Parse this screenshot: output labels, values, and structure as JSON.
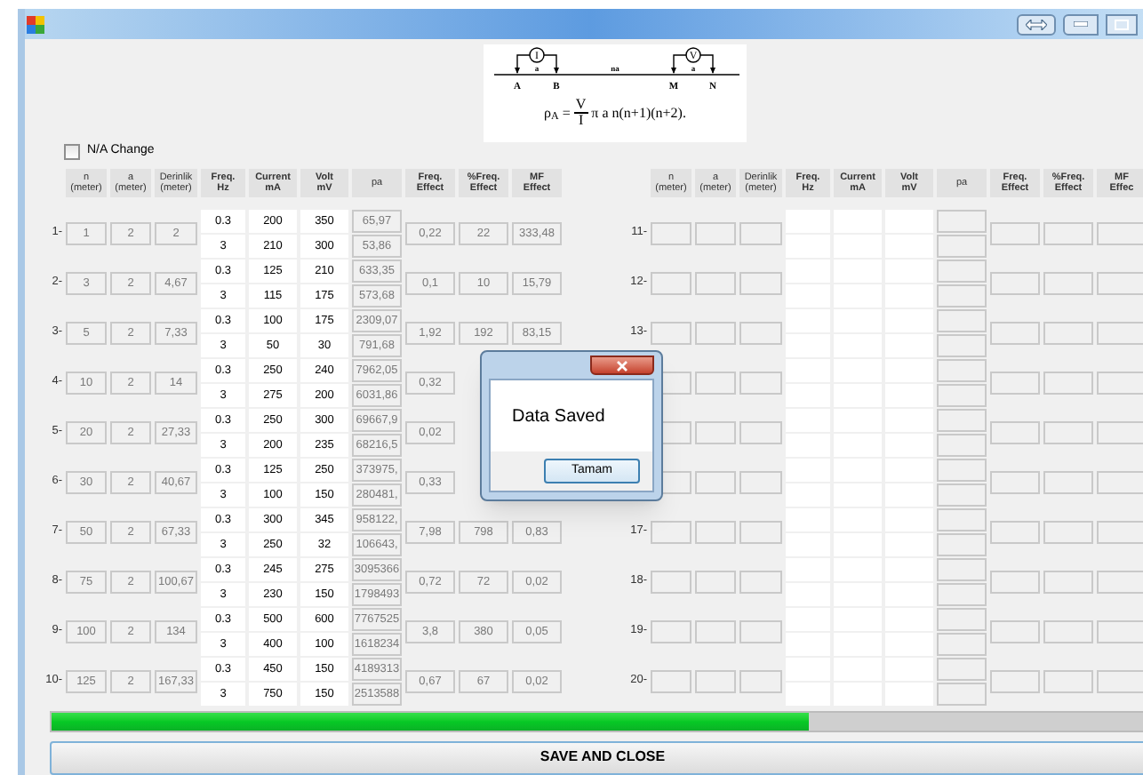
{
  "diagram": {
    "current_meter": "I",
    "voltage_meter": "V",
    "electrodes": [
      "A",
      "B",
      "M",
      "N"
    ],
    "spacings": [
      "a",
      "na",
      "a"
    ]
  },
  "formula": {
    "lhs": "ρ$_{A}$ =",
    "numerator": "V",
    "denominator": "I",
    "rhs": "π a n(n+1)(n+2)."
  },
  "na_change": {
    "label": "N/A Change",
    "checked": false
  },
  "left_table": {
    "columns": [
      {
        "lines": [
          "n",
          "(meter)"
        ]
      },
      {
        "lines": [
          "a",
          "(meter)"
        ]
      },
      {
        "lines": [
          "Derinlik",
          "(meter)"
        ]
      },
      {
        "lines": [
          "Freq.",
          "Hz"
        ]
      },
      {
        "lines": [
          "Current",
          "mA"
        ]
      },
      {
        "lines": [
          "Volt",
          "mV"
        ]
      },
      {
        "lines": [
          "pa"
        ]
      },
      {
        "lines": [
          "Freq.",
          "Effect"
        ]
      },
      {
        "lines": [
          "%Freq.",
          "Effect"
        ]
      },
      {
        "lines": [
          "MF",
          "Effect"
        ]
      }
    ],
    "rows": [
      {
        "label": "1-",
        "n": "1",
        "a": "2",
        "depth": "2",
        "freq": [
          "0.3",
          "3"
        ],
        "current": [
          "200",
          "210"
        ],
        "volt": [
          "350",
          "300"
        ],
        "pa": [
          "65,97",
          "53,86"
        ],
        "freq_effect": "0,22",
        "pct_freq_effect": "22",
        "mf_effect": "333,48"
      },
      {
        "label": "2-",
        "n": "3",
        "a": "2",
        "depth": "4,67",
        "freq": [
          "0.3",
          "3"
        ],
        "current": [
          "125",
          "115"
        ],
        "volt": [
          "210",
          "175"
        ],
        "pa": [
          "633,35",
          "573,68"
        ],
        "freq_effect": "0,1",
        "pct_freq_effect": "10",
        "mf_effect": "15,79"
      },
      {
        "label": "3-",
        "n": "5",
        "a": "2",
        "depth": "7,33",
        "freq": [
          "0.3",
          "3"
        ],
        "current": [
          "100",
          "50"
        ],
        "volt": [
          "175",
          "30"
        ],
        "pa": [
          "2309,07",
          "791,68"
        ],
        "freq_effect": "1,92",
        "pct_freq_effect": "192",
        "mf_effect": "83,15"
      },
      {
        "label": "4-",
        "n": "10",
        "a": "2",
        "depth": "14",
        "freq": [
          "0.3",
          "3"
        ],
        "current": [
          "250",
          "275"
        ],
        "volt": [
          "240",
          "200"
        ],
        "pa": [
          "7962,05",
          "6031,86"
        ],
        "freq_effect": "0,32"
      },
      {
        "label": "5-",
        "n": "20",
        "a": "2",
        "depth": "27,33",
        "freq": [
          "0.3",
          "3"
        ],
        "current": [
          "250",
          "200"
        ],
        "volt": [
          "300",
          "235"
        ],
        "pa": [
          "69667,9",
          "68216,5"
        ],
        "freq_effect": "0,02"
      },
      {
        "label": "6-",
        "n": "30",
        "a": "2",
        "depth": "40,67",
        "freq": [
          "0.3",
          "3"
        ],
        "current": [
          "125",
          "100"
        ],
        "volt": [
          "250",
          "150"
        ],
        "pa": [
          "373975,",
          "280481,"
        ],
        "freq_effect": "0,33"
      },
      {
        "label": "7-",
        "n": "50",
        "a": "2",
        "depth": "67,33",
        "freq": [
          "0.3",
          "3"
        ],
        "current": [
          "300",
          "250"
        ],
        "volt": [
          "345",
          "32"
        ],
        "pa": [
          "958122,",
          "106643,"
        ],
        "freq_effect": "7,98",
        "pct_freq_effect": "798",
        "mf_effect": "0,83"
      },
      {
        "label": "8-",
        "n": "75",
        "a": "2",
        "depth": "100,67",
        "freq": [
          "0.3",
          "3"
        ],
        "current": [
          "245",
          "230"
        ],
        "volt": [
          "275",
          "150"
        ],
        "pa": [
          "3095366",
          "1798493"
        ],
        "freq_effect": "0,72",
        "pct_freq_effect": "72",
        "mf_effect": "0,02"
      },
      {
        "label": "9-",
        "n": "100",
        "a": "2",
        "depth": "134",
        "freq": [
          "0.3",
          "3"
        ],
        "current": [
          "500",
          "400"
        ],
        "volt": [
          "600",
          "100"
        ],
        "pa": [
          "7767525",
          "1618234"
        ],
        "freq_effect": "3,8",
        "pct_freq_effect": "380",
        "mf_effect": "0,05"
      },
      {
        "label": "10-",
        "n": "125",
        "a": "2",
        "depth": "167,33",
        "freq": [
          "0.3",
          "3"
        ],
        "current": [
          "450",
          "750"
        ],
        "volt": [
          "150",
          "150"
        ],
        "pa": [
          "4189313",
          "2513588"
        ],
        "freq_effect": "0,67",
        "pct_freq_effect": "67",
        "mf_effect": "0,02"
      }
    ]
  },
  "right_table": {
    "columns": [
      {
        "lines": [
          "n",
          "(meter)"
        ]
      },
      {
        "lines": [
          "a",
          "(meter)"
        ]
      },
      {
        "lines": [
          "Derinlik",
          "(meter)"
        ]
      },
      {
        "lines": [
          "Freq.",
          "Hz"
        ]
      },
      {
        "lines": [
          "Current",
          "mA"
        ]
      },
      {
        "lines": [
          "Volt",
          "mV"
        ]
      },
      {
        "lines": [
          "pa"
        ]
      },
      {
        "lines": [
          "Freq.",
          "Effect"
        ]
      },
      {
        "lines": [
          "%Freq.",
          "Effect"
        ]
      },
      {
        "lines": [
          "MF",
          "Effec"
        ]
      }
    ],
    "rows": [
      {
        "label": "11-"
      },
      {
        "label": "12-"
      },
      {
        "label": "13-"
      },
      {},
      {},
      {},
      {
        "label": "17-"
      },
      {
        "label": "18-"
      },
      {
        "label": "19-"
      },
      {
        "label": "20-"
      }
    ]
  },
  "progress": {
    "level": 0.69
  },
  "save_button": "SAVE AND CLOSE",
  "dialog": {
    "message": "Data Saved",
    "button": "Tamam"
  }
}
